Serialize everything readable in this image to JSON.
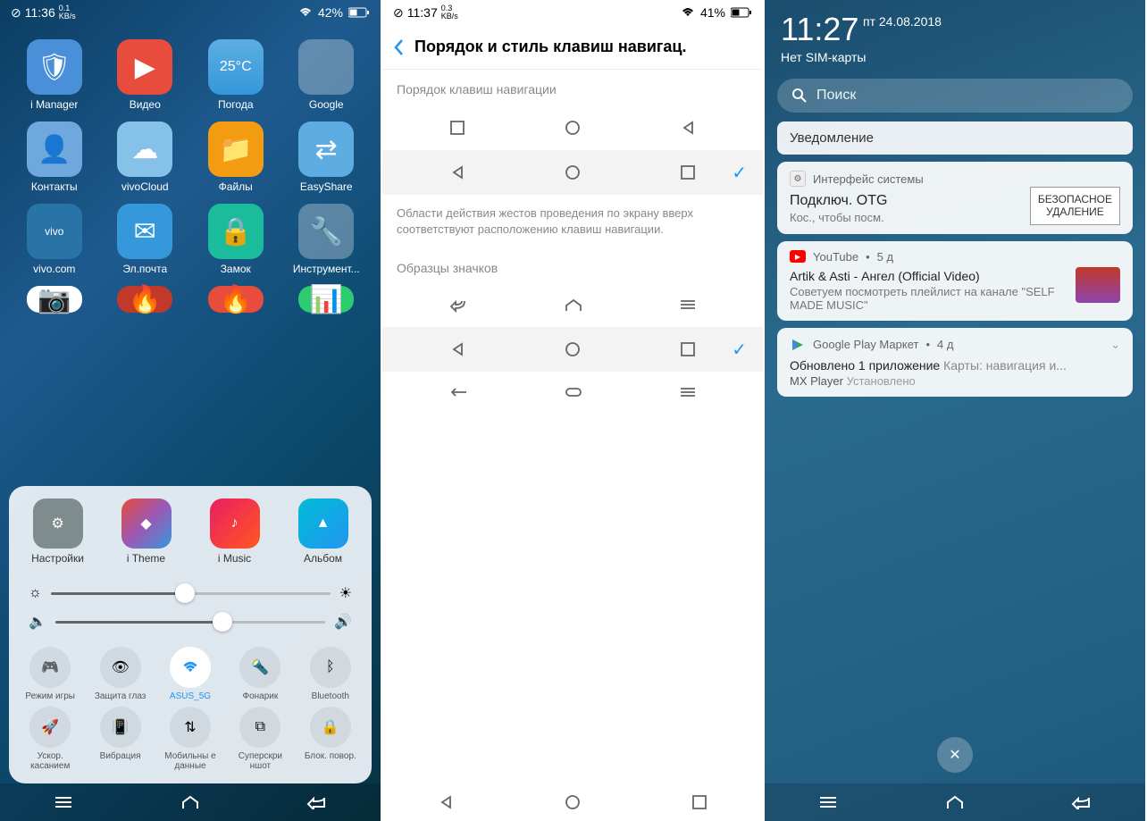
{
  "phone1": {
    "status": {
      "time": "11:36",
      "speed_val": "0.1",
      "speed_unit": "KB/s",
      "wifi": "42%",
      "battery": "42%"
    },
    "apps_row1": [
      {
        "label": "i Manager",
        "bg": "#4a90d9"
      },
      {
        "label": "Видео",
        "bg": "#e74c3c"
      },
      {
        "label": "Погода",
        "bg": "#5dade2",
        "badge": "25°C"
      },
      {
        "label": "Google",
        "bg": "#f0f0f0"
      }
    ],
    "apps_row2": [
      {
        "label": "Контакты",
        "bg": "#6fa8dc"
      },
      {
        "label": "vivoCloud",
        "bg": "#85c1e9"
      },
      {
        "label": "Файлы",
        "bg": "#f39c12"
      },
      {
        "label": "EasyShare",
        "bg": "#5dade2"
      }
    ],
    "apps_row3": [
      {
        "label": "vivo.com",
        "bg": "#2874a6"
      },
      {
        "label": "Эл.почта",
        "bg": "#3498db"
      },
      {
        "label": "Замок",
        "bg": "#1abc9c"
      },
      {
        "label": "Инструмент...",
        "bg": "#34495e"
      }
    ],
    "cc_apps": [
      {
        "label": "Настройки",
        "bg": "#7f8c8d"
      },
      {
        "label": "i Theme",
        "bg": "linear-gradient(135deg,#e74c3c,#9b59b6,#3498db)"
      },
      {
        "label": "i Music",
        "bg": "linear-gradient(135deg,#e91e63,#ff5722)"
      },
      {
        "label": "Альбом",
        "bg": "linear-gradient(135deg,#00bcd4,#2196f3)"
      }
    ],
    "brightness": 48,
    "volume": 62,
    "toggles_row1": [
      {
        "label": "Режим игры"
      },
      {
        "label": "Защита глаз"
      },
      {
        "label": "ASUS_5G",
        "active": true
      },
      {
        "label": "Фонарик"
      },
      {
        "label": "Bluetooth"
      }
    ],
    "toggles_row2": [
      {
        "label": "Ускор. касанием"
      },
      {
        "label": "Вибрация"
      },
      {
        "label": "Мобильны е данные"
      },
      {
        "label": "Суперскри ншот"
      },
      {
        "label": "Блок. повор."
      }
    ]
  },
  "phone2": {
    "status": {
      "time": "11:37",
      "speed_val": "0.3",
      "speed_unit": "KB/s",
      "battery": "41%"
    },
    "title": "Порядок и стиль клавиш навигац.",
    "section1": "Порядок клавиш навигации",
    "desc": "Области действия жестов проведения по экрану вверх соответствуют расположению клавиш навигации.",
    "section2": "Образцы значков"
  },
  "phone3": {
    "time": "11:27",
    "date": "пт 24.08.2018",
    "sim": "Нет SIM-карты",
    "search": "Поиск",
    "notif_label": "Уведомление",
    "n1": {
      "app": "Интерфейс системы",
      "title": "Подключ. OTG",
      "sub": "Кос., чтобы посм.",
      "btn1": "БЕЗОПАСНОЕ",
      "btn2": "УДАЛЕНИЕ"
    },
    "n2": {
      "app": "YouTube",
      "age": "5 д",
      "title": "Artik & Asti - Ангел (Official Video)",
      "sub": "Советуем посмотреть плейлист на канале \"SELF MADE MUSIC\""
    },
    "n3": {
      "app": "Google Play Маркет",
      "age": "4 д",
      "title_a": "Обновлено 1 приложение",
      "title_b": "Карты: навигация и...",
      "sub_a": "MX Player",
      "sub_b": "Установлено"
    }
  }
}
